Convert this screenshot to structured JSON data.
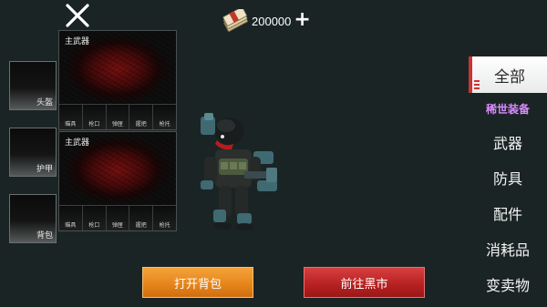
{
  "currency": {
    "amount": "200000",
    "add_symbol": "+",
    "icon": "cash-bundle-icon"
  },
  "close": {
    "icon": "close-icon",
    "symbol": "✕"
  },
  "slots": [
    {
      "label": "头盔"
    },
    {
      "label": "护甲"
    },
    {
      "label": "背包"
    }
  ],
  "weapons": [
    {
      "title": "主武器",
      "attachments": [
        "瞄具",
        "枪口",
        "弹匣",
        "握把",
        "枪托"
      ]
    },
    {
      "title": "主武器",
      "attachments": [
        "瞄具",
        "枪口",
        "弹匣",
        "握把",
        "枪托"
      ]
    }
  ],
  "menu": {
    "items": [
      {
        "label": "全部",
        "active": true
      },
      {
        "label": "稀世装备",
        "rare": true
      },
      {
        "label": "武器"
      },
      {
        "label": "防具"
      },
      {
        "label": "配件"
      },
      {
        "label": "消耗品"
      },
      {
        "label": "变卖物"
      }
    ]
  },
  "buttons": {
    "open_backpack": "打开背包",
    "go_black_market": "前往黑市"
  },
  "colors": {
    "background": "#1b2424",
    "rare": "#d98cff",
    "accent_red": "#cc3333",
    "orange_button": "#e6861c",
    "red_button": "#b82222"
  }
}
